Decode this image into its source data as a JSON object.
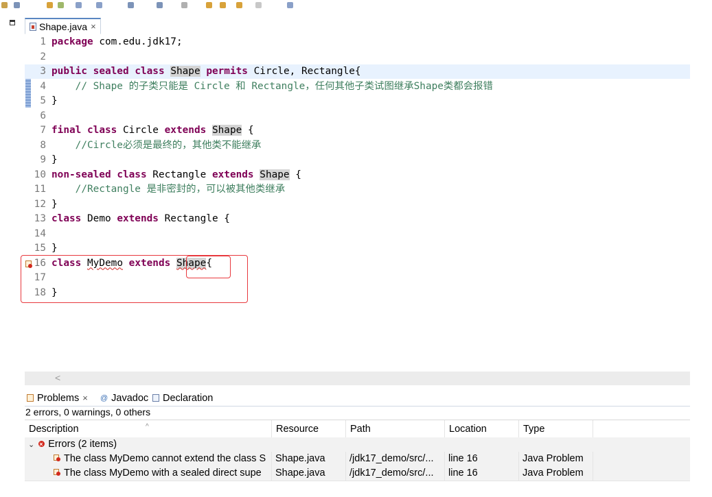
{
  "editor_tab": {
    "label": "Shape.java",
    "close": "×"
  },
  "code_lines": [
    {
      "num": "1",
      "segments": [
        {
          "t": "package",
          "c": "kw"
        },
        {
          "t": " com.edu.jdk17;",
          "c": ""
        }
      ]
    },
    {
      "num": "2",
      "segments": []
    },
    {
      "num": "3",
      "segments": [
        {
          "t": "public",
          "c": "kw"
        },
        {
          "t": " ",
          "c": ""
        },
        {
          "t": "sealed",
          "c": "kw"
        },
        {
          "t": " ",
          "c": ""
        },
        {
          "t": "class",
          "c": "kw"
        },
        {
          "t": " ",
          "c": ""
        },
        {
          "t": "Shape",
          "c": "hl"
        },
        {
          "t": " ",
          "c": ""
        },
        {
          "t": "permits",
          "c": "kw"
        },
        {
          "t": " Circle, Rectangle{",
          "c": ""
        }
      ]
    },
    {
      "num": "4",
      "segments": [
        {
          "t": "    // Shape 的子类只能是 Circle 和 Rectangle，任何其他子类试图继承Shape类都会报错",
          "c": "cm"
        }
      ]
    },
    {
      "num": "5",
      "segments": [
        {
          "t": "}",
          "c": ""
        }
      ]
    },
    {
      "num": "6",
      "segments": []
    },
    {
      "num": "7",
      "segments": [
        {
          "t": "final",
          "c": "kw"
        },
        {
          "t": " ",
          "c": ""
        },
        {
          "t": "class",
          "c": "kw"
        },
        {
          "t": " Circle ",
          "c": ""
        },
        {
          "t": "extends",
          "c": "kw"
        },
        {
          "t": " ",
          "c": ""
        },
        {
          "t": "Shape",
          "c": "hl"
        },
        {
          "t": " {",
          "c": ""
        }
      ]
    },
    {
      "num": "8",
      "segments": [
        {
          "t": "    //Circle必须是最终的，其他类不能继承",
          "c": "cm"
        }
      ]
    },
    {
      "num": "9",
      "segments": [
        {
          "t": "}",
          "c": ""
        }
      ]
    },
    {
      "num": "10",
      "segments": [
        {
          "t": "non-sealed",
          "c": "kw"
        },
        {
          "t": " ",
          "c": ""
        },
        {
          "t": "class",
          "c": "kw"
        },
        {
          "t": " Rectangle ",
          "c": ""
        },
        {
          "t": "extends",
          "c": "kw"
        },
        {
          "t": " ",
          "c": ""
        },
        {
          "t": "Shape",
          "c": "hl"
        },
        {
          "t": " {",
          "c": ""
        }
      ]
    },
    {
      "num": "11",
      "segments": [
        {
          "t": "    //Rectangle 是非密封的，可以被其他类继承",
          "c": "cm"
        }
      ]
    },
    {
      "num": "12",
      "segments": [
        {
          "t": "}",
          "c": ""
        }
      ]
    },
    {
      "num": "13",
      "segments": [
        {
          "t": "class",
          "c": "kw"
        },
        {
          "t": " Demo ",
          "c": ""
        },
        {
          "t": "extends",
          "c": "kw"
        },
        {
          "t": " Rectangle {",
          "c": ""
        }
      ]
    },
    {
      "num": "14",
      "segments": []
    },
    {
      "num": "15",
      "segments": [
        {
          "t": "}",
          "c": ""
        }
      ]
    },
    {
      "num": "16",
      "segments": [
        {
          "t": "class",
          "c": "kw"
        },
        {
          "t": " ",
          "c": ""
        },
        {
          "t": "MyDemo",
          "c": "squig"
        },
        {
          "t": " ",
          "c": ""
        },
        {
          "t": "extends",
          "c": "kw"
        },
        {
          "t": " ",
          "c": ""
        },
        {
          "t": "Shape",
          "c": "hl squig"
        },
        {
          "t": "{",
          "c": ""
        }
      ]
    },
    {
      "num": "17",
      "segments": []
    },
    {
      "num": "18",
      "segments": [
        {
          "t": "}",
          "c": ""
        }
      ]
    }
  ],
  "panel": {
    "tabs": {
      "problems": "Problems",
      "problems_close": "×",
      "javadoc": "Javadoc",
      "declaration": "Declaration"
    },
    "summary": "2 errors, 0 warnings, 0 others",
    "columns": {
      "description": "Description",
      "resource": "Resource",
      "path": "Path",
      "location": "Location",
      "type": "Type"
    },
    "group": {
      "label": "Errors (2 items)"
    },
    "rows": [
      {
        "description": "The class MyDemo cannot extend the class S",
        "resource": "Shape.java",
        "path": "/jdk17_demo/src/...",
        "location": "line 16",
        "type": "Java Problem"
      },
      {
        "description": "The class MyDemo with a sealed direct supe",
        "resource": "Shape.java",
        "path": "/jdk17_demo/src/...",
        "location": "line 16",
        "type": "Java Problem"
      }
    ]
  },
  "colors": {
    "keyword": "#7f0055",
    "comment": "#3f7f5f",
    "error": "#d2291d",
    "annotation_box": "#e8383d",
    "current_line": "#e8f2fe"
  },
  "icons": [
    "java-file-icon",
    "error-icon",
    "problem-marker-icon",
    "problems-view-icon",
    "javadoc-icon",
    "declaration-icon"
  ]
}
